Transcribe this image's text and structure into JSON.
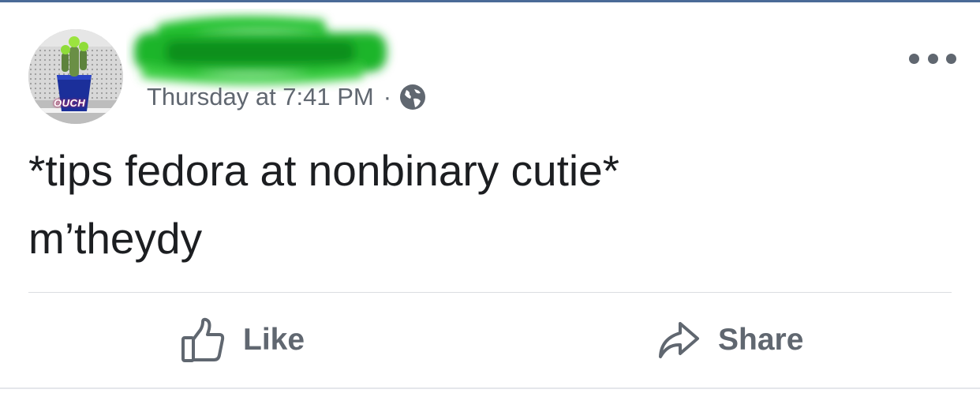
{
  "post": {
    "author_avatar_caption": "OUCH",
    "timestamp": "Thursday at 7:41 PM",
    "separator": "·",
    "privacy_icon": "globe-icon",
    "more_icon": "more-horizontal-icon",
    "text_lines": [
      "*tips fedora at nonbinary cutie*",
      "m’theydy"
    ],
    "actions": {
      "like_label": "Like",
      "like_icon": "thumbs-up-icon",
      "share_label": "Share",
      "share_icon": "share-arrow-icon"
    }
  },
  "colors": {
    "top_rule": "#4a6a97",
    "secondary_text": "#606770",
    "primary_text": "#1c1e21",
    "redaction_green": "#1fbf2a"
  }
}
